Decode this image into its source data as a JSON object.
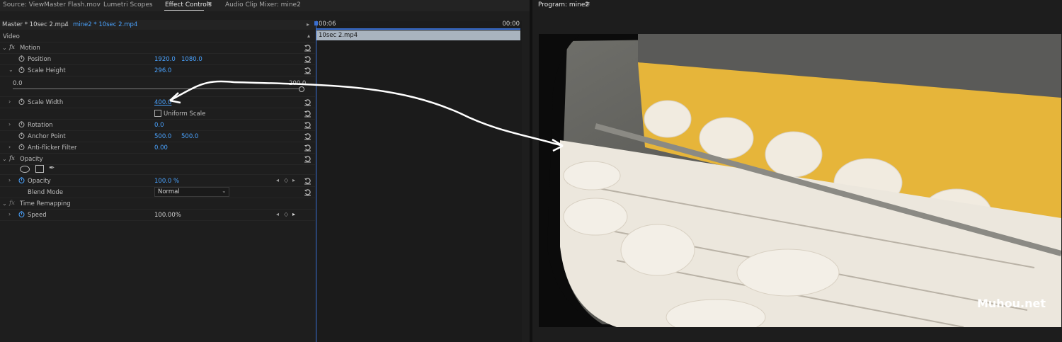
{
  "tabs": [
    {
      "label": "Source: ViewMaster Flash.mov",
      "active": false
    },
    {
      "label": "Lumetri Scopes",
      "active": false
    },
    {
      "label": "Effect Controls",
      "active": true
    },
    {
      "label": "Audio Clip Mixer: mine2",
      "active": false
    }
  ],
  "program": {
    "title": "Program: mine2"
  },
  "clip_selector": {
    "master": "Master * 10sec 2.mp4",
    "sequence": "mine2 * 10sec 2.mp4"
  },
  "timeline": {
    "start_time": "00:06",
    "end_time": "00:00",
    "clip_name": "10sec 2.mp4"
  },
  "section": {
    "video": "Video"
  },
  "effects": {
    "motion": {
      "label": "Motion",
      "icon": "fx"
    },
    "position": {
      "label": "Position",
      "x": "1920.0",
      "y": "1080.0"
    },
    "scale_height": {
      "label": "Scale Height",
      "value": "296.0",
      "slider_min": "0.0",
      "slider_max": "200.0"
    },
    "scale_width": {
      "label": "Scale Width",
      "value": "400.0"
    },
    "uniform_scale": {
      "label": "Uniform Scale",
      "checked": false
    },
    "rotation": {
      "label": "Rotation",
      "value": "0.0"
    },
    "anchor_point": {
      "label": "Anchor Point",
      "x": "500.0",
      "y": "500.0"
    },
    "anti_flicker": {
      "label": "Anti-flicker Filter",
      "value": "0.00"
    },
    "opacity_group": {
      "label": "Opacity"
    },
    "opacity": {
      "label": "Opacity",
      "value": "100.0 %"
    },
    "blend_mode": {
      "label": "Blend Mode",
      "value": "Normal"
    },
    "time_remapping": {
      "label": "Time Remapping"
    },
    "speed": {
      "label": "Speed",
      "value": "100.00%"
    }
  },
  "watermark": "Muhou.net",
  "colors": {
    "accent": "#4aa3ff",
    "playhead": "#3a6fd1",
    "clip": "#a9b4bf"
  }
}
